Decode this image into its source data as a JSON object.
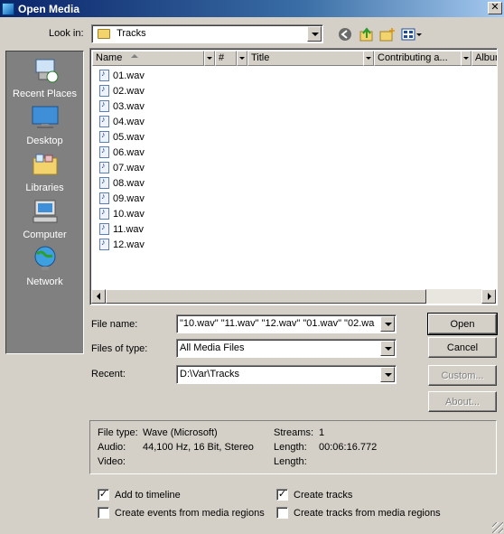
{
  "window": {
    "title": "Open Media",
    "close_glyph": "✕"
  },
  "lookin": {
    "label": "Look in:",
    "value": "Tracks"
  },
  "toolbar": {
    "icons": [
      "back-icon",
      "up-folder-icon",
      "new-folder-icon",
      "view-menu-icon"
    ]
  },
  "places": [
    {
      "label": "Recent Places",
      "icon": "recent-places-icon"
    },
    {
      "label": "Desktop",
      "icon": "desktop-icon"
    },
    {
      "label": "Libraries",
      "icon": "libraries-icon"
    },
    {
      "label": "Computer",
      "icon": "computer-icon"
    },
    {
      "label": "Network",
      "icon": "network-icon"
    }
  ],
  "columns": [
    "Name",
    "#",
    "Title",
    "Contributing a...",
    "Albur"
  ],
  "files": [
    "01.wav",
    "02.wav",
    "03.wav",
    "04.wav",
    "05.wav",
    "06.wav",
    "07.wav",
    "08.wav",
    "09.wav",
    "10.wav",
    "11.wav",
    "12.wav"
  ],
  "fields": {
    "filename_label": "File name:",
    "filename_value": "\"10.wav\" \"11.wav\" \"12.wav\" \"01.wav\" \"02.wa",
    "filetype_label": "Files of type:",
    "filetype_value": "All Media Files",
    "recent_label": "Recent:",
    "recent_value": "D:\\Var\\Tracks"
  },
  "buttons": {
    "open": "Open",
    "cancel": "Cancel",
    "custom": "Custom...",
    "about": "About..."
  },
  "info": {
    "filetype_label": "File type:",
    "filetype_value": "Wave (Microsoft)",
    "audio_label": "Audio:",
    "audio_value": "44,100 Hz, 16 Bit, Stereo",
    "video_label": "Video:",
    "streams_label": "Streams:",
    "streams_value": "1",
    "length_label": "Length:",
    "length_value": "00:06:16.772",
    "length2_label": "Length:"
  },
  "options": {
    "add_timeline": {
      "label": "Add to timeline",
      "checked": true
    },
    "create_events": {
      "label": "Create events from media regions",
      "checked": false
    },
    "create_tracks": {
      "label": "Create tracks",
      "checked": true
    },
    "create_tracks_regions": {
      "label": "Create tracks from media regions",
      "checked": false
    }
  }
}
